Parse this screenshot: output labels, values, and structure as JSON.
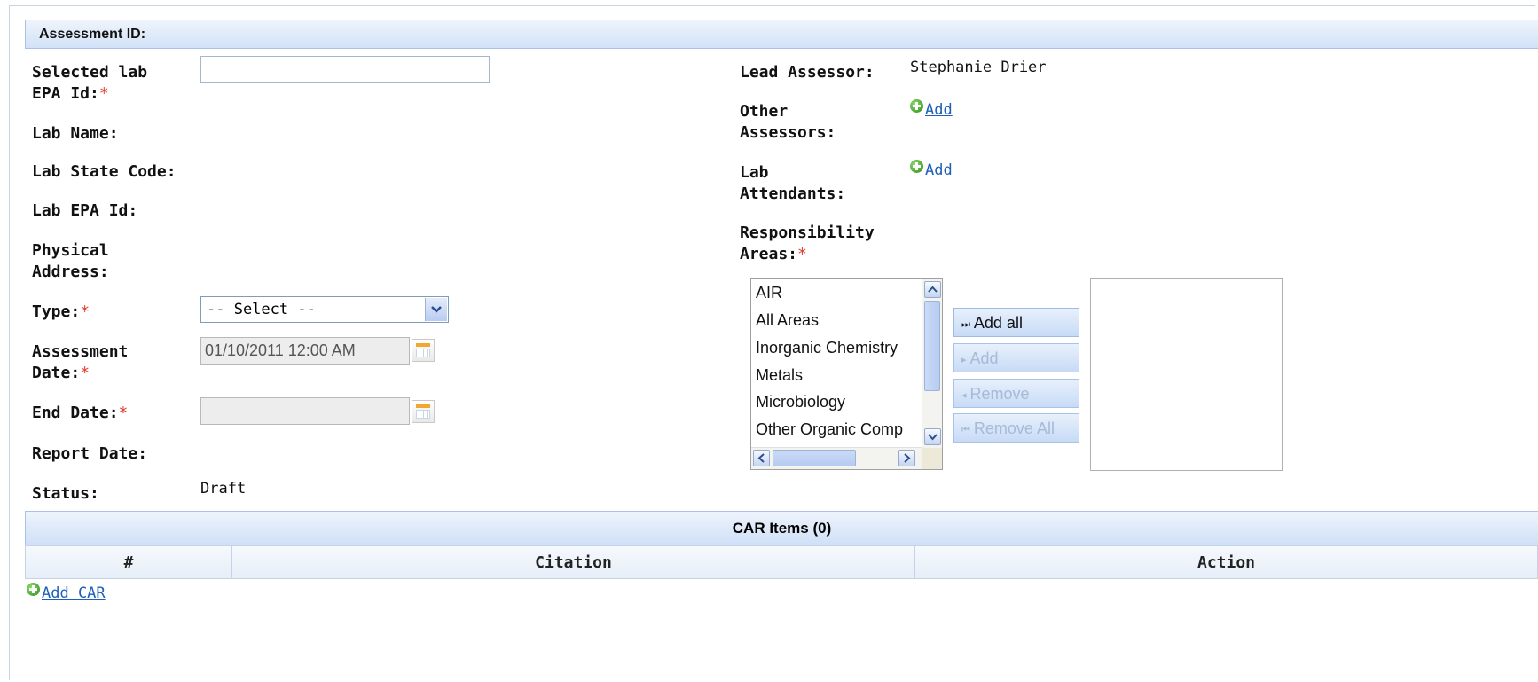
{
  "section": {
    "title": "Assessment ID:"
  },
  "form_left": {
    "selected_lab_label_1": "Selected lab",
    "selected_lab_label_2": "EPA Id:",
    "selected_lab_value": "",
    "lab_name_label": "Lab Name:",
    "lab_state_label": "Lab State Code:",
    "lab_epa_label": "Lab EPA Id:",
    "physical_address_label_1": "Physical",
    "physical_address_label_2": "Address:",
    "type_label": "Type:",
    "type_selected": "-- Select --",
    "assessment_date_label_1": "Assessment",
    "assessment_date_label_2": "Date:",
    "assessment_date_value": "01/10/2011 12:00 AM",
    "end_date_label": "End Date:",
    "end_date_value": "",
    "report_date_label": "Report Date:",
    "status_label": "Status:",
    "status_value": "Draft",
    "required_mark": "*"
  },
  "form_right": {
    "lead_assessor_label": "Lead Assessor:",
    "lead_assessor_value": "Stephanie Drier",
    "other_assessors_label_1": "Other",
    "other_assessors_label_2": "Assessors:",
    "other_assessors_add": "Add",
    "lab_attendants_label_1": "Lab",
    "lab_attendants_label_2": "Attendants:",
    "lab_attendants_add": "Add",
    "responsibility_label_1": "Responsibility",
    "responsibility_label_2": "Areas:"
  },
  "available_areas": [
    "AIR",
    "All Areas",
    "Inorganic Chemistry",
    "Metals",
    "Microbiology",
    "Other Organic Comp"
  ],
  "move_buttons": {
    "add_all": "Add all",
    "add": "Add",
    "remove": "Remove",
    "remove_all": "Remove All"
  },
  "car": {
    "title": "CAR Items (0)",
    "columns": [
      "#",
      "Citation",
      "Action"
    ],
    "add_label": "Add CAR"
  },
  "colors": {
    "accent": "#d2e2f7",
    "link": "#1e5fb8",
    "required": "#e23a2a"
  }
}
